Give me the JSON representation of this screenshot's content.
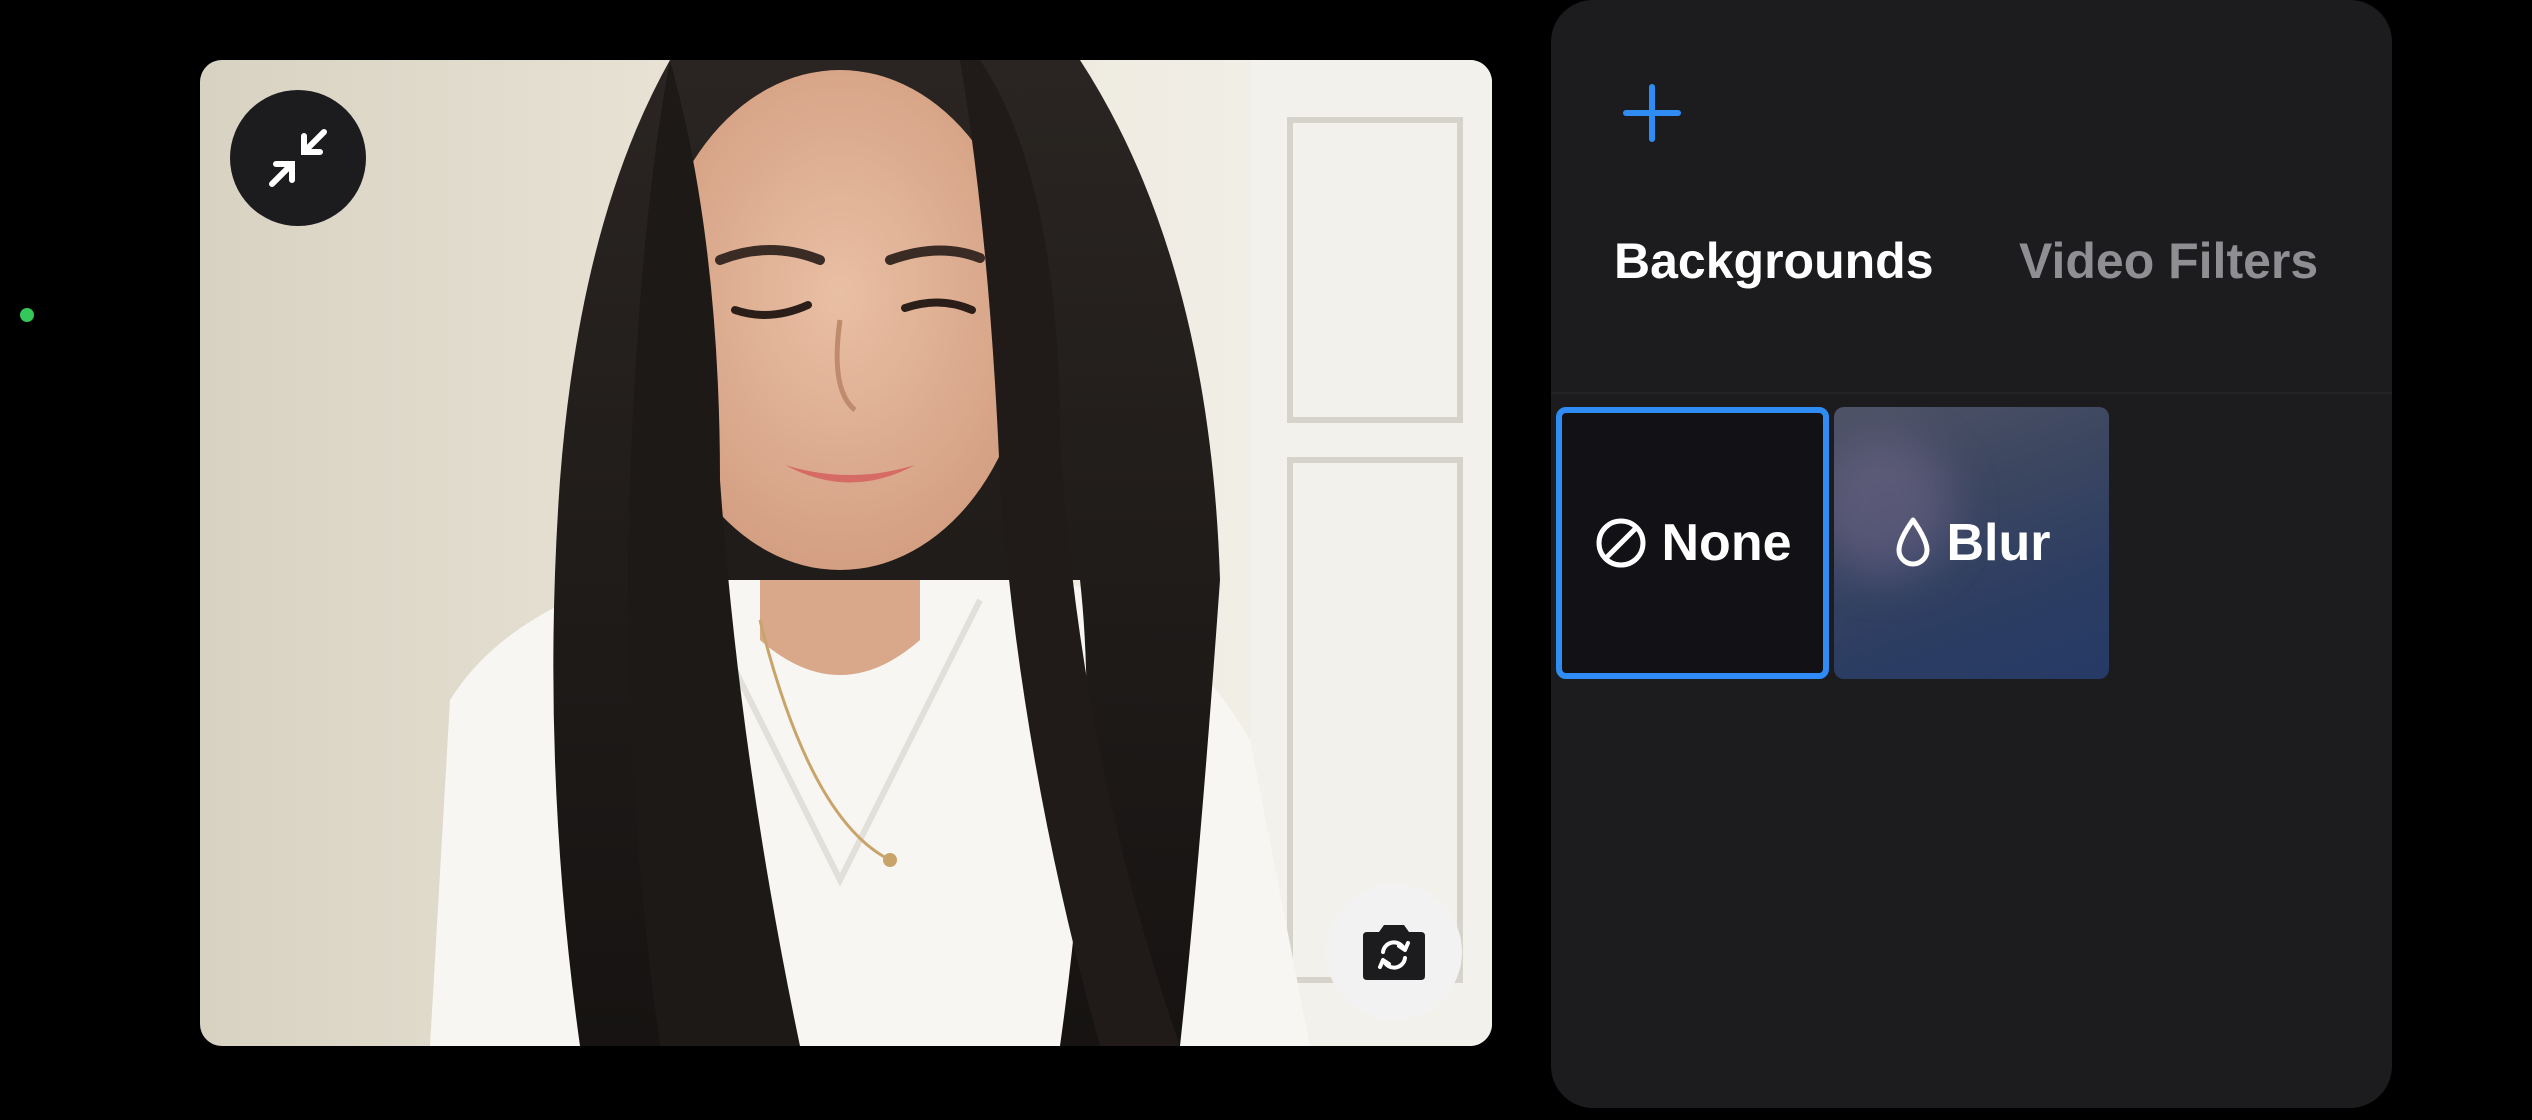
{
  "status_indicator": {
    "color": "#34c759"
  },
  "preview": {
    "collapse_icon": "arrows-collapse-icon",
    "flip_camera_icon": "camera-flip-icon"
  },
  "panel": {
    "add_icon": "plus-icon",
    "accent_color": "#2f8cf5",
    "tabs": [
      {
        "label": "Backgrounds",
        "selected": true
      },
      {
        "label": "Video Filters",
        "selected": false
      }
    ],
    "backgrounds": [
      {
        "label": "None",
        "icon": "prohibited-icon",
        "selected": true
      },
      {
        "label": "Blur",
        "icon": "droplet-icon",
        "selected": false
      }
    ]
  }
}
